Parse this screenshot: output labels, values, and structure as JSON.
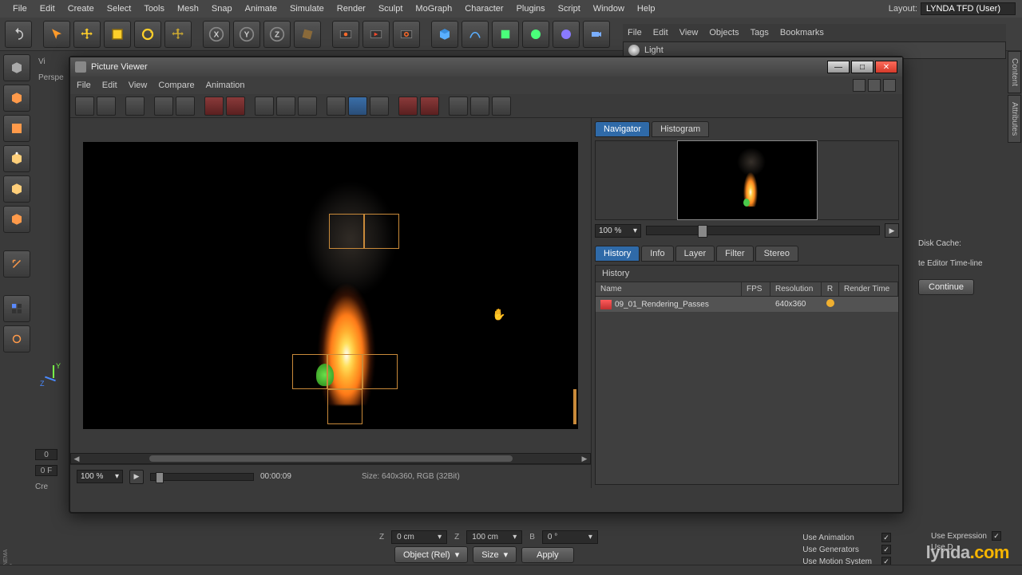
{
  "menubar": [
    "File",
    "Edit",
    "Create",
    "Select",
    "Tools",
    "Mesh",
    "Snap",
    "Animate",
    "Simulate",
    "Render",
    "Sculpt",
    "MoGraph",
    "Character",
    "Plugins",
    "Script",
    "Window",
    "Help"
  ],
  "layout_label": "Layout:",
  "layout_value": "LYNDA TFD (User)",
  "objects_menu": [
    "File",
    "Edit",
    "View",
    "Objects",
    "Tags",
    "Bookmarks"
  ],
  "scene_object": "Light",
  "persp": "Perspe",
  "view_menu_partial": "Vi",
  "pv": {
    "title": "Picture Viewer",
    "menu": [
      "File",
      "Edit",
      "View",
      "Compare",
      "Animation"
    ],
    "nav_tabs": [
      "Navigator",
      "Histogram"
    ],
    "nav_zoom": "100 %",
    "info_tabs": [
      "History",
      "Info",
      "Layer",
      "Filter",
      "Stereo"
    ],
    "history_title": "History",
    "cols": {
      "name": "Name",
      "fps": "FPS",
      "res": "Resolution",
      "r": "R",
      "rt": "Render Time"
    },
    "row": {
      "name": "09_01_Rendering_Passes",
      "fps": "",
      "res": "640x360"
    },
    "zoom": "100 %",
    "time": "00:00:09",
    "size": "Size: 640x360, RGB (32Bit)"
  },
  "coords": {
    "z1": "Z",
    "z1v": "0 cm",
    "z2": "Z",
    "z2v": "100 cm",
    "b": "B",
    "bv": "0 °"
  },
  "dd1": "Object (Rel)",
  "dd2": "Size",
  "apply": "Apply",
  "checks1": [
    "Use Animation",
    "Use Generators",
    "Use Motion System"
  ],
  "checks2": [
    "Use Expression",
    "Use D"
  ],
  "disk_cache": "Disk Cache:",
  "timeline_label": "te Editor Time-line",
  "continue": "Continue",
  "tl": {
    "zero": "0",
    "zerof": "0 F",
    "cre": "Cre"
  },
  "watermark": {
    "a": "lynda",
    "b": ".com"
  }
}
